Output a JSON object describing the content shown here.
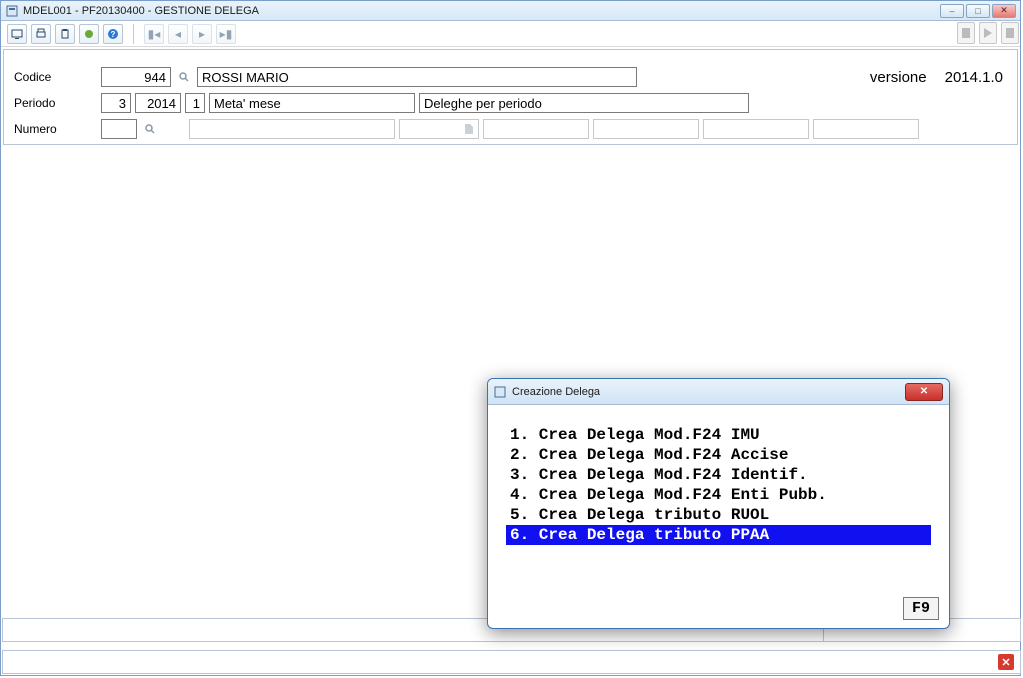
{
  "window": {
    "title": "MDEL001  - PF20130400 -  GESTIONE DELEGA"
  },
  "form": {
    "labels": {
      "codice": "Codice",
      "periodo": "Periodo",
      "numero": "Numero"
    },
    "codice_value": "944",
    "codice_name": "ROSSI MARIO",
    "periodo_month": "3",
    "periodo_year": "2014",
    "periodo_seq": "1",
    "periodo_desc": "Meta' mese",
    "periodo_type": "Deleghe per periodo",
    "numero_value": ""
  },
  "version": {
    "label": "versione",
    "value": "2014.1.0"
  },
  "dialog": {
    "title": "Creazione Delega",
    "items": [
      "1. Crea Delega Mod.F24 IMU",
      "2. Crea Delega Mod.F24 Accise",
      "3. Crea Delega Mod.F24 Identif.",
      "4. Crea Delega Mod.F24 Enti Pubb.",
      "5. Crea Delega tributo RUOL",
      "6. Crea Delega tributo PPAA"
    ],
    "selected_index": 5,
    "shortcut_button": "F9"
  }
}
